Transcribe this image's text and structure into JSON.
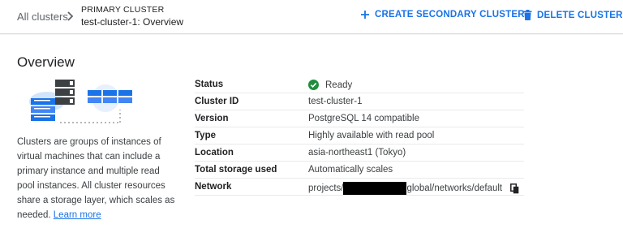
{
  "breadcrumb": {
    "root": "All clusters",
    "kicker": "PRIMARY CLUSTER",
    "title": "test-cluster-1: Overview"
  },
  "actions": {
    "create_label": "CREATE SECONDARY CLUSTER",
    "delete_label": "DELETE CLUSTER"
  },
  "overview": {
    "title": "Overview",
    "description": "Clusters are groups of instances of virtual machines that can include a primary instance and multiple read pool instances. All cluster resources share a storage layer, which scales as needed.",
    "learn_more": "Learn more"
  },
  "details": {
    "status_label": "Status",
    "status_value": "Ready",
    "cluster_id_label": "Cluster ID",
    "cluster_id_value": "test-cluster-1",
    "version_label": "Version",
    "version_value": "PostgreSQL 14 compatible",
    "type_label": "Type",
    "type_value": "Highly available with read pool",
    "location_label": "Location",
    "location_value": "asia-northeast1 (Tokyo)",
    "storage_label": "Total storage used",
    "storage_value": "Automatically scales",
    "network_label": "Network",
    "network_prefix": "projects/",
    "network_suffix": "global/networks/default"
  },
  "colors": {
    "accent": "#1a73e8",
    "ready": "#1e8e3e"
  },
  "icons": {
    "chevron": "chevron-right-icon",
    "create": "plus-icon",
    "delete": "trash-icon",
    "status": "check-circle-icon",
    "copy": "copy-icon"
  }
}
